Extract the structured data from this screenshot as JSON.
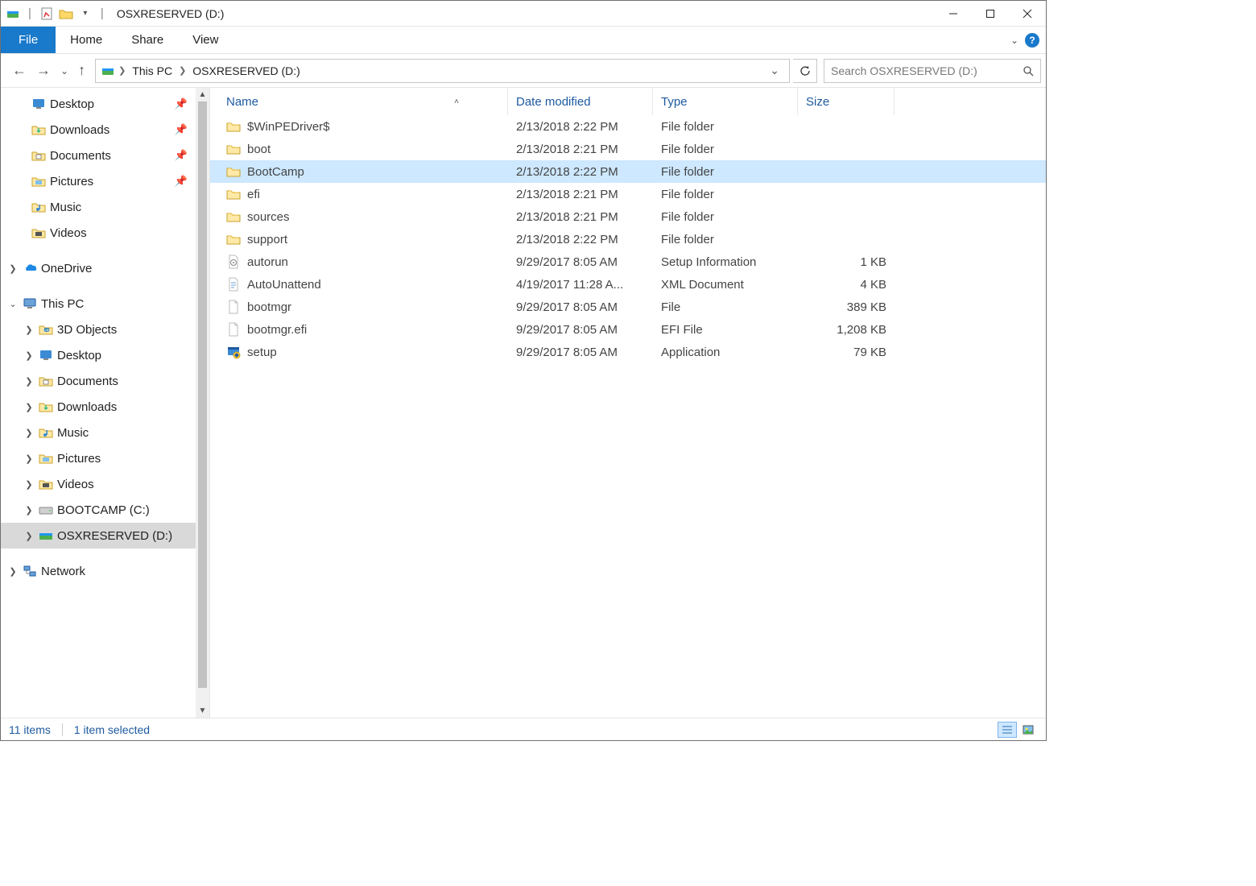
{
  "window": {
    "title": "OSXRESERVED (D:)"
  },
  "ribbon": {
    "file": "File",
    "tabs": [
      "Home",
      "Share",
      "View"
    ]
  },
  "breadcrumb": {
    "items": [
      "This PC",
      "OSXRESERVED (D:)"
    ]
  },
  "search": {
    "placeholder": "Search OSXRESERVED (D:)"
  },
  "sidebar": {
    "quick": [
      {
        "label": "Desktop"
      },
      {
        "label": "Downloads"
      },
      {
        "label": "Documents"
      },
      {
        "label": "Pictures"
      },
      {
        "label": "Music"
      },
      {
        "label": "Videos"
      }
    ],
    "onedrive": "OneDrive",
    "thispc": {
      "label": "This PC",
      "children": [
        {
          "label": "3D Objects"
        },
        {
          "label": "Desktop"
        },
        {
          "label": "Documents"
        },
        {
          "label": "Downloads"
        },
        {
          "label": "Music"
        },
        {
          "label": "Pictures"
        },
        {
          "label": "Videos"
        },
        {
          "label": "BOOTCAMP (C:)"
        },
        {
          "label": "OSXRESERVED (D:)",
          "selected": true
        }
      ]
    },
    "network": "Network"
  },
  "columns": {
    "name": "Name",
    "date": "Date modified",
    "type": "Type",
    "size": "Size"
  },
  "files": [
    {
      "name": "$WinPEDriver$",
      "date": "2/13/2018 2:22 PM",
      "type": "File folder",
      "size": "",
      "icon": "folder"
    },
    {
      "name": "boot",
      "date": "2/13/2018 2:21 PM",
      "type": "File folder",
      "size": "",
      "icon": "folder"
    },
    {
      "name": "BootCamp",
      "date": "2/13/2018 2:22 PM",
      "type": "File folder",
      "size": "",
      "icon": "folder",
      "selected": true
    },
    {
      "name": "efi",
      "date": "2/13/2018 2:21 PM",
      "type": "File folder",
      "size": "",
      "icon": "folder"
    },
    {
      "name": "sources",
      "date": "2/13/2018 2:21 PM",
      "type": "File folder",
      "size": "",
      "icon": "folder"
    },
    {
      "name": "support",
      "date": "2/13/2018 2:22 PM",
      "type": "File folder",
      "size": "",
      "icon": "folder"
    },
    {
      "name": "autorun",
      "date": "9/29/2017 8:05 AM",
      "type": "Setup Information",
      "size": "1 KB",
      "icon": "inf"
    },
    {
      "name": "AutoUnattend",
      "date": "4/19/2017 11:28 A...",
      "type": "XML Document",
      "size": "4 KB",
      "icon": "xml"
    },
    {
      "name": "bootmgr",
      "date": "9/29/2017 8:05 AM",
      "type": "File",
      "size": "389 KB",
      "icon": "file"
    },
    {
      "name": "bootmgr.efi",
      "date": "9/29/2017 8:05 AM",
      "type": "EFI File",
      "size": "1,208 KB",
      "icon": "file"
    },
    {
      "name": "setup",
      "date": "9/29/2017 8:05 AM",
      "type": "Application",
      "size": "79 KB",
      "icon": "app"
    }
  ],
  "status": {
    "count": "11 items",
    "selected": "1 item selected"
  }
}
